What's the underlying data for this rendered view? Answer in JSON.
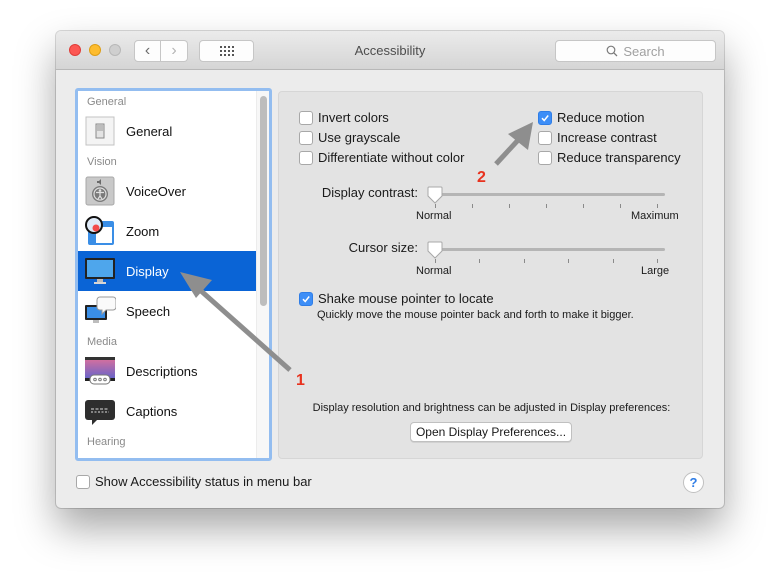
{
  "window": {
    "title": "Accessibility",
    "search_placeholder": "Search"
  },
  "sidebar": {
    "sections": [
      {
        "header": "General",
        "items": [
          {
            "label": "General",
            "icon": "general-switch-icon"
          }
        ]
      },
      {
        "header": "Vision",
        "items": [
          {
            "label": "VoiceOver",
            "icon": "voiceover-icon"
          },
          {
            "label": "Zoom",
            "icon": "zoom-magnifier-icon"
          },
          {
            "label": "Display",
            "icon": "display-monitor-icon",
            "selected": true
          },
          {
            "label": "Speech",
            "icon": "speech-bubble-icon"
          }
        ]
      },
      {
        "header": "Media",
        "items": [
          {
            "label": "Descriptions",
            "icon": "descriptions-icon"
          },
          {
            "label": "Captions",
            "icon": "captions-icon"
          }
        ]
      },
      {
        "header": "Hearing",
        "items": []
      }
    ]
  },
  "display_panel": {
    "options_left": [
      {
        "label": "Invert colors",
        "checked": false
      },
      {
        "label": "Use grayscale",
        "checked": false
      },
      {
        "label": "Differentiate without color",
        "checked": false
      }
    ],
    "options_right": [
      {
        "label": "Reduce motion",
        "checked": true
      },
      {
        "label": "Increase contrast",
        "checked": false
      },
      {
        "label": "Reduce transparency",
        "checked": false
      }
    ],
    "display_contrast": {
      "label": "Display contrast:",
      "min_label": "Normal",
      "max_label": "Maximum",
      "value": 0
    },
    "cursor_size": {
      "label": "Cursor size:",
      "min_label": "Normal",
      "max_label": "Large",
      "value": 0
    },
    "shake_pointer": {
      "label": "Shake mouse pointer to locate",
      "checked": true,
      "description": "Quickly move the mouse pointer back and forth to make it bigger."
    },
    "display_prefs_note": "Display resolution and brightness can be adjusted in Display preferences:",
    "open_display_prefs_label": "Open Display Preferences..."
  },
  "footer": {
    "show_status_label": "Show Accessibility status in menu bar",
    "show_status_checked": false,
    "help_label": "?"
  },
  "annotations": {
    "step1": "1",
    "step2": "2",
    "color": "#e8321e"
  },
  "colors": {
    "selection": "#0a64d6",
    "checkbox_checked": "#3d8ef7",
    "focus_ring": "#93bdf0"
  }
}
